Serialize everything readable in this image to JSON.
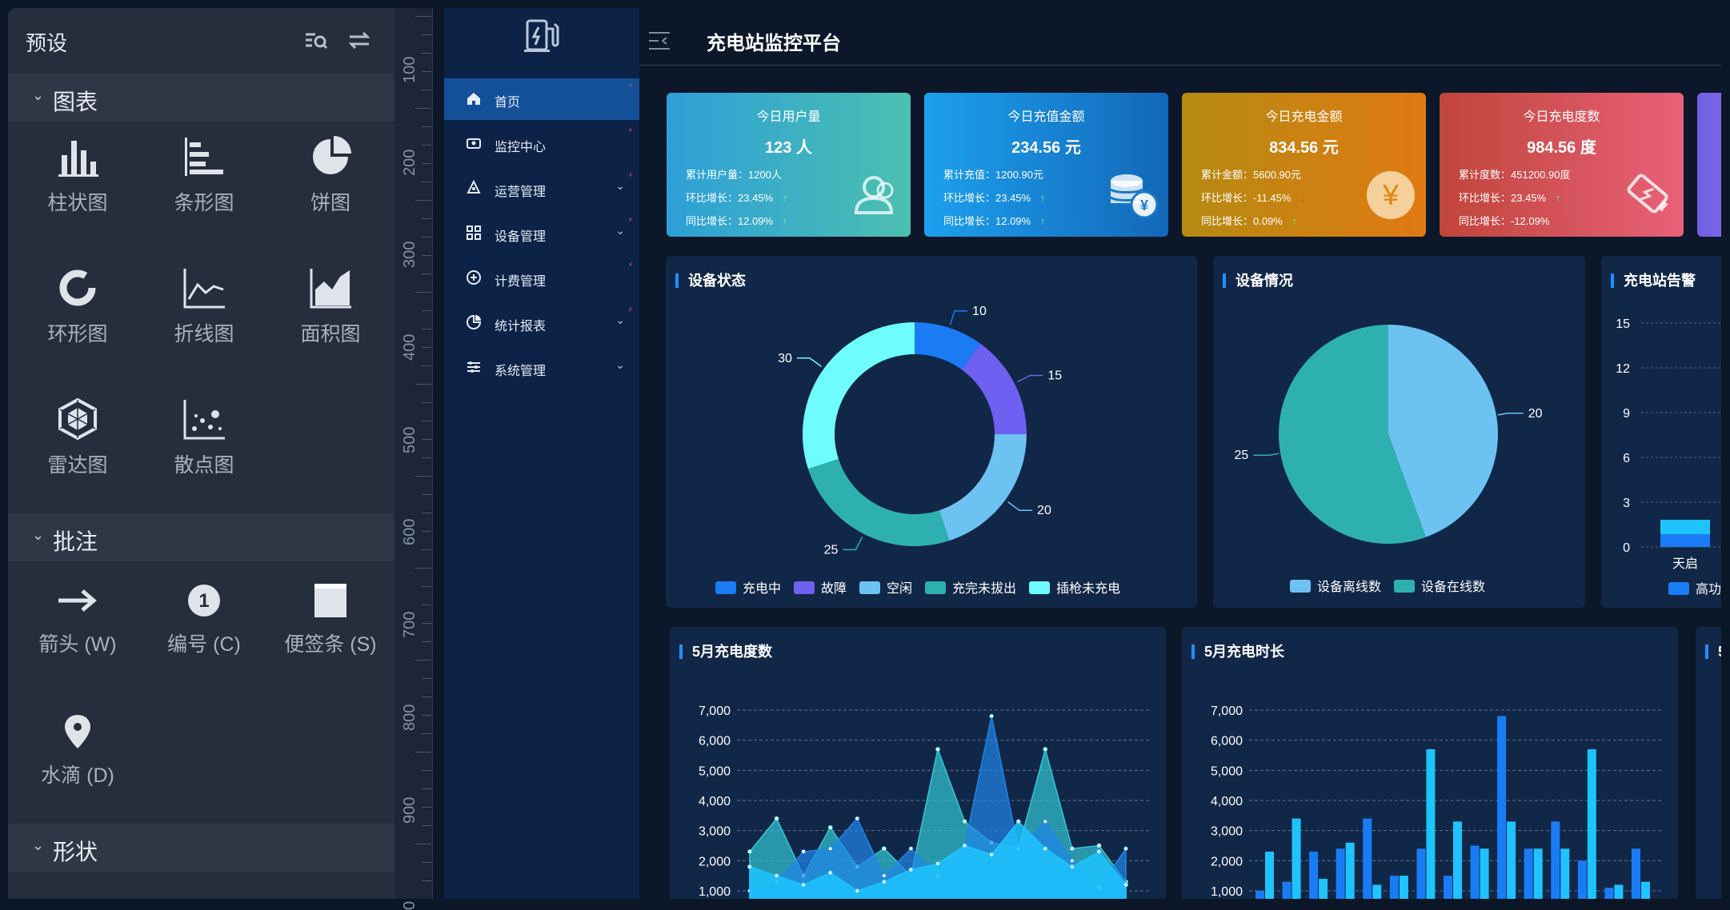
{
  "preset": {
    "title": "预设",
    "sections": [
      {
        "title": "图表",
        "tools": [
          "柱状图",
          "条形图",
          "饼图",
          "环形图",
          "折线图",
          "面积图",
          "雷达图",
          "散点图"
        ]
      },
      {
        "title": "批注",
        "tools": [
          "箭头 (W)",
          "编号 (C)",
          "便签条 (S)",
          "水滴 (D)"
        ]
      },
      {
        "title": "形状",
        "tools": []
      }
    ]
  },
  "ruler": {
    "labels": [
      "100",
      "200",
      "300",
      "400",
      "500",
      "600",
      "700",
      "800",
      "900",
      "0"
    ]
  },
  "dashboard": {
    "title": "充电站监控平台",
    "nav": [
      {
        "label": "首页",
        "icon": "home-icon",
        "arrow": false
      },
      {
        "label": "监控中心",
        "icon": "monitor-icon",
        "arrow": false
      },
      {
        "label": "运营管理",
        "icon": "operation-icon",
        "arrow": true
      },
      {
        "label": "设备管理",
        "icon": "grid-icon",
        "arrow": true
      },
      {
        "label": "计费管理",
        "icon": "billing-icon",
        "arrow": false
      },
      {
        "label": "统计报表",
        "icon": "report-icon",
        "arrow": true
      },
      {
        "label": "系统管理",
        "icon": "settings-icon",
        "arrow": true
      }
    ],
    "kpis": [
      {
        "title": "今日用户量",
        "value": "123 人",
        "l1": "累计用户量：1200人",
        "l2": "环比增长：23.45%",
        "l2_arrow": "↑",
        "l3": "同比增长：12.09%",
        "l3_arrow": "↑",
        "icon": "users-icon",
        "gradient": [
          "#2d9fd8",
          "#4cc0b0"
        ]
      },
      {
        "title": "今日充值金额",
        "value": "234.56 元",
        "l1": "累计充值：1200.90元",
        "l2": "环比增长：23.45%",
        "l2_arrow": "↑",
        "l3": "同比增长：12.09%",
        "l3_arrow": "↑",
        "icon": "coins-icon",
        "gradient": [
          "#1ca0ee",
          "#1367b8"
        ]
      },
      {
        "title": "今日充电金额",
        "value": "834.56 元",
        "l1": "累计金额：5600.90元",
        "l2": "环比增长：-11.45%",
        "l2_arrow": "↓",
        "l3": "同比增长：0.09%",
        "l3_arrow": "↑",
        "icon": "yuan-icon",
        "gradient": [
          "#b58a12",
          "#e07a12"
        ]
      },
      {
        "title": "今日充电度数",
        "value": "984.56 度",
        "l1": "累计度数：451200.90度",
        "l2": "环比增长：23.45%",
        "l2_arrow": "↑",
        "l3": "同比增长：-12.09%",
        "l3_arrow": "↓",
        "icon": "battery-icon",
        "gradient": [
          "#c0453b",
          "#e86178"
        ]
      }
    ],
    "panels": {
      "status_title": "设备状态",
      "situation_title": "设备情况",
      "alarm_title": "充电站告警",
      "energy_title": "5月充电度数",
      "duration_title": "5月充电时长",
      "extra_title": "5"
    },
    "alarm_partial": {
      "yticks": [
        "15",
        "12",
        "9",
        "6",
        "3",
        "0"
      ],
      "xlabel": "天启",
      "legend": "高功"
    }
  },
  "chart_data": [
    {
      "type": "pie",
      "variant": "donut",
      "title": "设备状态",
      "categories": [
        "充电中",
        "故障",
        "空闲",
        "充完未拔出",
        "插枪未充电"
      ],
      "values": [
        10,
        15,
        20,
        25,
        30
      ],
      "colors": [
        "#1a7cf5",
        "#6e60f0",
        "#6cc3f2",
        "#2fb0b0",
        "#6efcfc"
      ],
      "legend": "bottom"
    },
    {
      "type": "pie",
      "title": "设备情况",
      "categories": [
        "设备离线数",
        "设备在线数"
      ],
      "values": [
        20,
        25
      ],
      "colors": [
        "#6cc3f2",
        "#2fb0b0"
      ],
      "legend": "bottom"
    },
    {
      "type": "area",
      "title": "5月充电度数",
      "ylim": [
        0,
        7000
      ],
      "yticks": [
        1000,
        2000,
        3000,
        4000,
        5000,
        6000,
        7000
      ],
      "series": [
        {
          "values": [
            2300,
            3400,
            1500,
            3100,
            1800,
            2400,
            1500,
            5700,
            3300,
            2600,
            2400,
            5700,
            2400,
            2500,
            1300
          ],
          "color": "#33c8d6"
        },
        {
          "values": [
            1000,
            1300,
            2300,
            2400,
            3400,
            1500,
            2400,
            1500,
            2500,
            6800,
            2400,
            3300,
            2000,
            1100,
            2400
          ],
          "color": "#1f86e8"
        },
        {
          "values": [
            1800,
            1500,
            1200,
            1600,
            1000,
            1300,
            1700,
            1900,
            2500,
            2200,
            3300,
            2400,
            1800,
            2300,
            1200
          ],
          "color": "#1ec3ff"
        }
      ]
    },
    {
      "type": "bar",
      "title": "5月充电时长",
      "ylim": [
        0,
        7000
      ],
      "yticks": [
        1000,
        2000,
        3000,
        4000,
        5000,
        6000,
        7000
      ],
      "series": [
        {
          "values": [
            1000,
            1300,
            2300,
            2400,
            3400,
            1500,
            2400,
            1500,
            2500,
            6800,
            2400,
            3300,
            2000,
            1100,
            2400
          ],
          "color": "#1a7cf5"
        },
        {
          "values": [
            2300,
            3400,
            1400,
            2600,
            1200,
            1500,
            5700,
            3300,
            2400,
            3300,
            2400,
            2400,
            5700,
            1200,
            1300
          ],
          "color": "#1ec3ff"
        }
      ]
    }
  ]
}
